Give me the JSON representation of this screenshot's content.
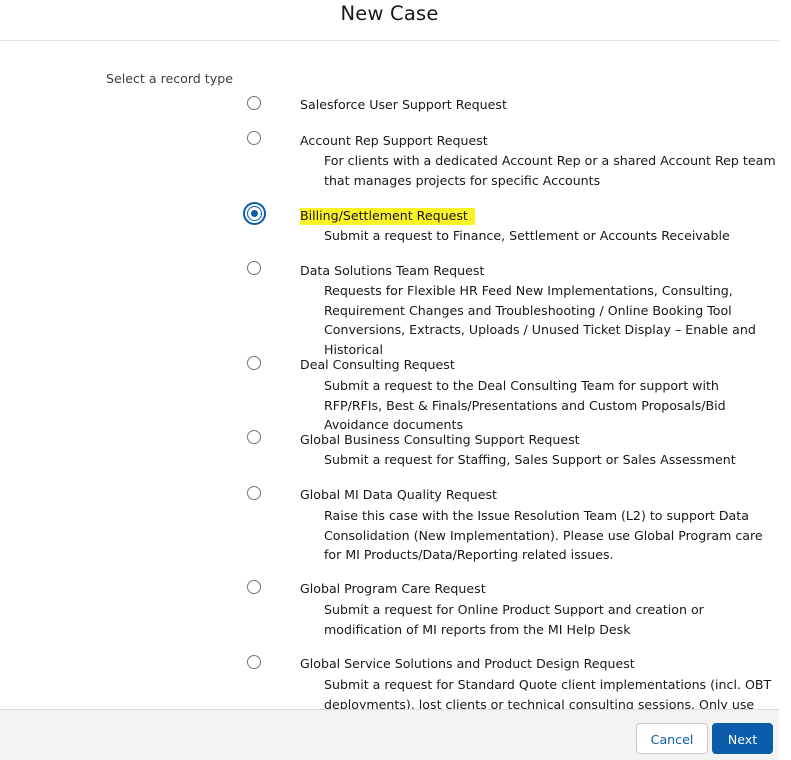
{
  "header": {
    "title": "New Case"
  },
  "form": {
    "label": "Select a record type",
    "options": [
      {
        "label": "Salesforce User Support Request",
        "desc": "",
        "selected": false
      },
      {
        "label": "Account Rep Support Request",
        "desc": "For clients with a dedicated Account Rep or a shared Account Rep team that manages projects for specific Accounts",
        "selected": false
      },
      {
        "label": "Billing/Settlement Request",
        "desc": "Submit a request to Finance, Settlement or Accounts Receivable",
        "selected": true
      },
      {
        "label": "Data Solutions Team Request",
        "desc": "Requests for Flexible HR Feed New Implementations, Consulting, Requirement Changes and Troubleshooting / Online Booking Tool Conversions, Extracts, Uploads / Unused Ticket Display – Enable and Historical",
        "selected": false
      },
      {
        "label": "Deal Consulting Request",
        "desc": "Submit a request to the Deal Consulting Team for support with RFP/RFIs, Best & Finals/Presentations and Custom Proposals/Bid Avoidance documents",
        "selected": false
      },
      {
        "label": "Global Business Consulting Support Request",
        "desc": "Submit a request for Staffing, Sales Support or Sales Assessment",
        "selected": false
      },
      {
        "label": "Global MI Data Quality Request",
        "desc": "Raise this case with the Issue Resolution Team (L2) to support Data Consolidation (New Implementation). Please use Global Program care for MI Products/Data/Reporting related issues.",
        "selected": false
      },
      {
        "label": "Global Program Care Request",
        "desc": "Submit a request for Online Product Support and creation or modification of MI reports from the MI Help Desk",
        "selected": false
      },
      {
        "label": "Global Service Solutions and Product Design Request",
        "desc": "Submit a request for Standard Quote client implementations (incl. OBT deployments), lost clients or technical consulting sessions. Only use Custom",
        "selected": false
      }
    ]
  },
  "footer": {
    "cancel_label": "Cancel",
    "next_label": "Next"
  },
  "colors": {
    "brand": "#0b5cab",
    "highlight": "#fbf326",
    "footer_bg": "#f3f3f3"
  }
}
